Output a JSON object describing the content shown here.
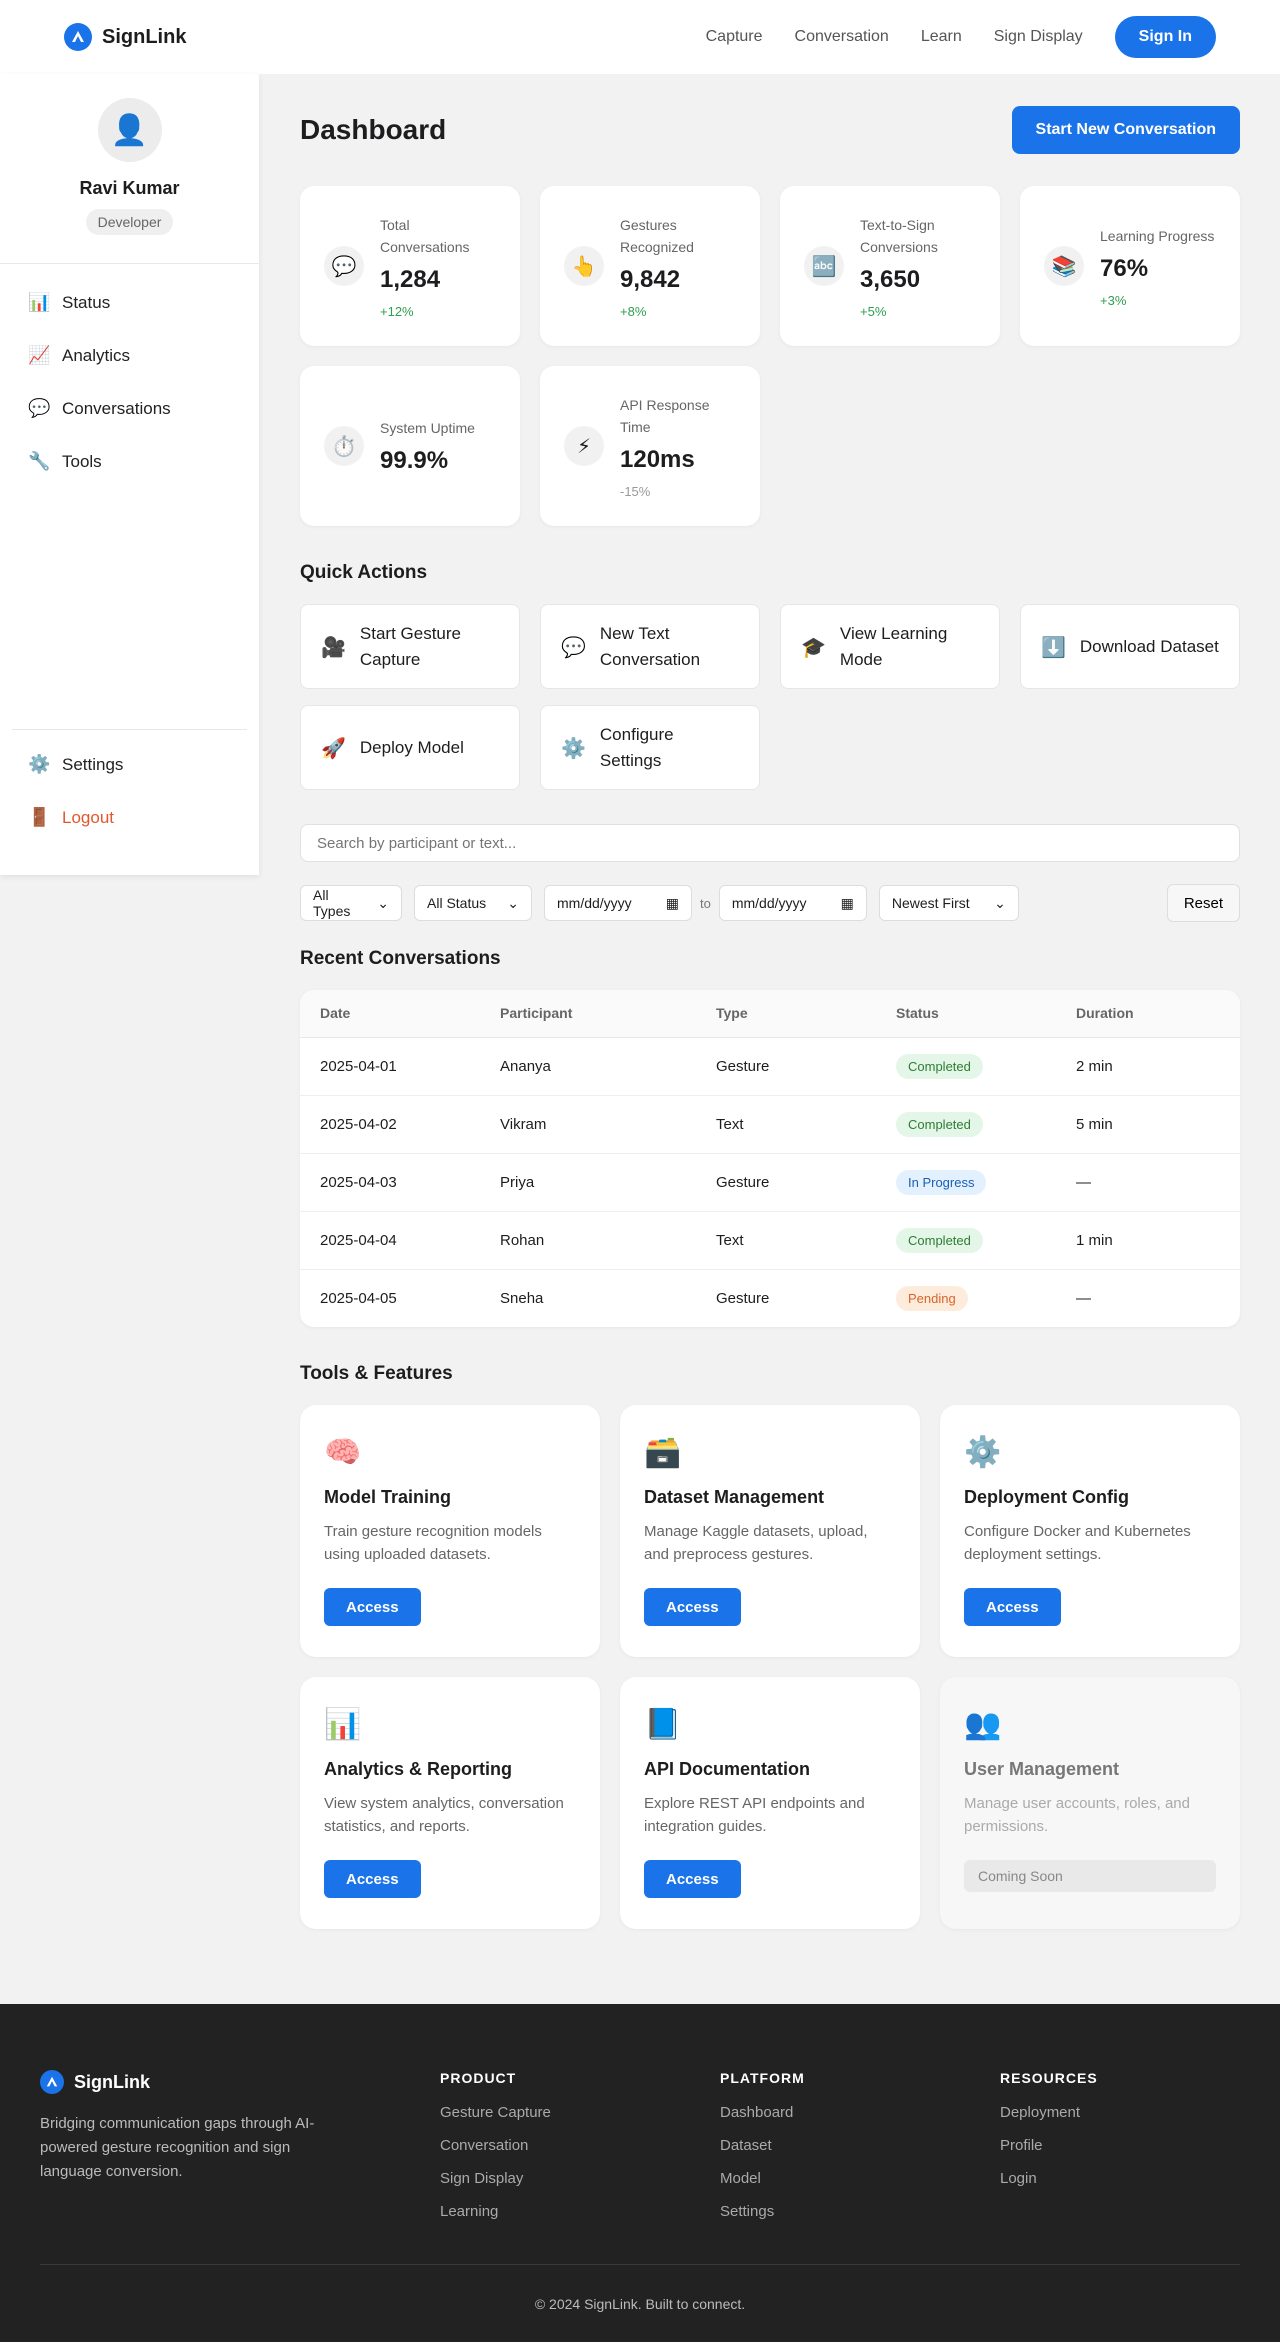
{
  "brand": {
    "name": "SignLink"
  },
  "nav": {
    "links": [
      "Capture",
      "Conversation",
      "Learn",
      "Sign Display"
    ],
    "signin": "Sign In"
  },
  "profile": {
    "name": "Ravi Kumar",
    "role": "Developer",
    "avatar_icon": "user-icon"
  },
  "sidebar": {
    "items": [
      {
        "icon": "📊",
        "label": "Status"
      },
      {
        "icon": "📈",
        "label": "Analytics"
      },
      {
        "icon": "💬",
        "label": "Conversations"
      },
      {
        "icon": "🔧",
        "label": "Tools"
      }
    ],
    "bottom": [
      {
        "icon": "⚙️",
        "label": "Settings"
      },
      {
        "icon": "🚪",
        "label": "Logout"
      }
    ]
  },
  "dashboard": {
    "title": "Dashboard",
    "cta": "Start New Conversation"
  },
  "stats": [
    {
      "icon": "💬",
      "label": "Total Conversations",
      "value": "1,284",
      "change": "+12%"
    },
    {
      "icon": "👆",
      "label": "Gestures Recognized",
      "value": "9,842",
      "change": "+8%"
    },
    {
      "icon": "🔤",
      "label": "Text-to-Sign Conversions",
      "value": "3,650",
      "change": "+5%"
    },
    {
      "icon": "📚",
      "label": "Learning Progress",
      "value": "76%",
      "change": "+3%"
    },
    {
      "icon": "⏱️",
      "label": "System Uptime",
      "value": "99.9%",
      "change": ""
    },
    {
      "icon": "⚡",
      "label": "API Response Time",
      "value": "120ms",
      "change": "-15%"
    }
  ],
  "quick_actions": {
    "title": "Quick Actions",
    "items": [
      {
        "icon": "🎥",
        "label": "Start Gesture Capture"
      },
      {
        "icon": "💬",
        "label": "New Text Conversation"
      },
      {
        "icon": "🎓",
        "label": "View Learning Mode"
      },
      {
        "icon": "⬇️",
        "label": "Download Dataset"
      },
      {
        "icon": "🚀",
        "label": "Deploy Model"
      },
      {
        "icon": "⚙️",
        "label": "Configure Settings"
      }
    ]
  },
  "filters": {
    "search_placeholder": "Search by participant or text...",
    "type": "All Types",
    "status": "All Status",
    "date_from": "mm/dd/yyyy",
    "to": "to",
    "date_to": "mm/dd/yyyy",
    "sort": "Newest First",
    "reset": "Reset"
  },
  "recent": {
    "title": "Recent Conversations",
    "columns": [
      "Date",
      "Participant",
      "Type",
      "Status",
      "Duration"
    ],
    "rows": [
      {
        "date": "2025-04-01",
        "participant": "Ananya",
        "type": "Gesture",
        "status": "Completed",
        "status_kind": "completed",
        "duration": "2 min"
      },
      {
        "date": "2025-04-02",
        "participant": "Vikram",
        "type": "Text",
        "status": "Completed",
        "status_kind": "completed",
        "duration": "5 min"
      },
      {
        "date": "2025-04-03",
        "participant": "Priya",
        "type": "Gesture",
        "status": "In Progress",
        "status_kind": "progress",
        "duration": "—"
      },
      {
        "date": "2025-04-04",
        "participant": "Rohan",
        "type": "Text",
        "status": "Completed",
        "status_kind": "completed",
        "duration": "1 min"
      },
      {
        "date": "2025-04-05",
        "participant": "Sneha",
        "type": "Gesture",
        "status": "Pending",
        "status_kind": "pending",
        "duration": "—"
      }
    ]
  },
  "tools": {
    "title": "Tools & Features",
    "items": [
      {
        "icon": "🧠",
        "title": "Model Training",
        "desc": "Train gesture recognition models using uploaded datasets.",
        "button": "Access",
        "enabled": true
      },
      {
        "icon": "🗃️",
        "title": "Dataset Management",
        "desc": "Manage Kaggle datasets, upload, and preprocess gestures.",
        "button": "Access",
        "enabled": true
      },
      {
        "icon": "⚙️",
        "title": "Deployment Config",
        "desc": "Configure Docker and Kubernetes deployment settings.",
        "button": "Access",
        "enabled": true
      },
      {
        "icon": "📊",
        "title": "Analytics & Reporting",
        "desc": "View system analytics, conversation statistics, and reports.",
        "button": "Access",
        "enabled": true
      },
      {
        "icon": "📘",
        "title": "API Documentation",
        "desc": "Explore REST API endpoints and integration guides.",
        "button": "Access",
        "enabled": true
      },
      {
        "icon": "👥",
        "title": "User Management",
        "desc": "Manage user accounts, roles, and permissions.",
        "button": "Coming Soon",
        "enabled": false
      }
    ]
  },
  "footer": {
    "brand": "SignLink",
    "desc": "Bridging communication gaps through AI-powered gesture recognition and sign language conversion.",
    "columns": [
      {
        "title": "PRODUCT",
        "links": [
          "Gesture Capture",
          "Conversation",
          "Sign Display",
          "Learning"
        ]
      },
      {
        "title": "PLATFORM",
        "links": [
          "Dashboard",
          "Dataset",
          "Model",
          "Settings"
        ]
      },
      {
        "title": "RESOURCES",
        "links": [
          "Deployment",
          "Profile",
          "Login"
        ]
      }
    ],
    "copyright": "© 2024 SignLink. Built to connect."
  },
  "colors": {
    "accent": "#1a73e8",
    "success": "#2e9e4f",
    "danger": "#e4572e",
    "footer_bg": "#222222"
  }
}
